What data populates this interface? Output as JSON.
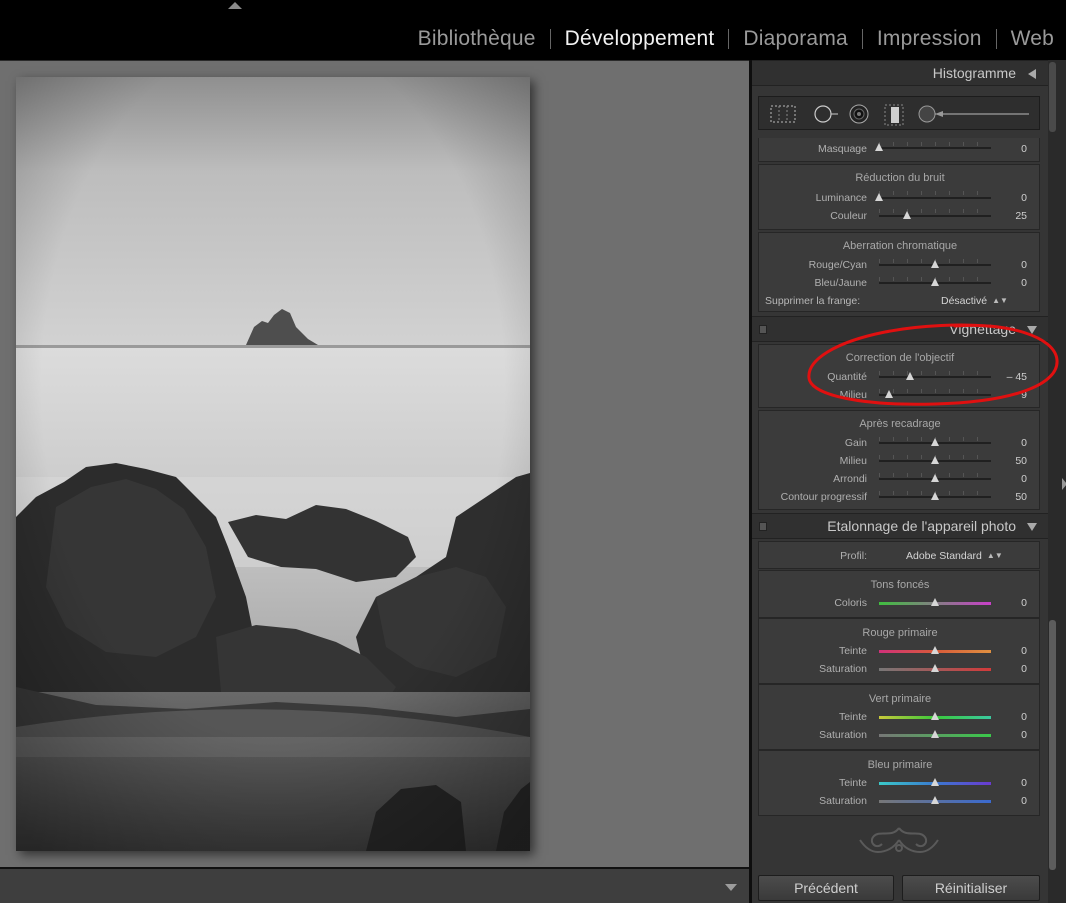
{
  "modules": [
    {
      "label": "Bibliothèque",
      "active": false
    },
    {
      "label": "Développement",
      "active": true
    },
    {
      "label": "Diaporama",
      "active": false
    },
    {
      "label": "Impression",
      "active": false
    },
    {
      "label": "Web",
      "active": false
    }
  ],
  "histogram": {
    "title": "Histogramme"
  },
  "detail": {
    "masquage_label": "Masquage",
    "masquage_value": "0",
    "masquage_fraction": 0.0
  },
  "noise": {
    "title": "Réduction du bruit",
    "rows": [
      {
        "label": "Luminance",
        "value": "0",
        "fraction": 0.0
      },
      {
        "label": "Couleur",
        "value": "25",
        "fraction": 0.25
      }
    ]
  },
  "chromatic": {
    "title": "Aberration chromatique",
    "rows": [
      {
        "label": "Rouge/Cyan",
        "value": "0",
        "fraction": 0.5
      },
      {
        "label": "Bleu/Jaune",
        "value": "0",
        "fraction": 0.5
      }
    ],
    "fringe_label": "Supprimer la frange:",
    "fringe_value": "Désactivé"
  },
  "vignette": {
    "title": "Vignettage",
    "lens_title": "Correction de l'objectif",
    "lens_rows": [
      {
        "label": "Quantité",
        "value": "– 45",
        "fraction": 0.275
      },
      {
        "label": "Milieu",
        "value": "9",
        "fraction": 0.09
      }
    ],
    "crop_title": "Après recadrage",
    "crop_rows": [
      {
        "label": "Gain",
        "value": "0",
        "fraction": 0.5
      },
      {
        "label": "Milieu",
        "value": "50",
        "fraction": 0.5
      },
      {
        "label": "Arrondi",
        "value": "0",
        "fraction": 0.5
      },
      {
        "label": "Contour progressif",
        "value": "50",
        "fraction": 0.5
      }
    ]
  },
  "calibration": {
    "title": "Etalonnage de l'appareil photo",
    "profile_label": "Profil:",
    "profile_value": "Adobe Standard",
    "shadows_title": "Tons foncés",
    "shadows_row": {
      "label": "Coloris",
      "value": "0",
      "fraction": 0.5
    },
    "red_title": "Rouge primaire",
    "red_rows": [
      {
        "label": "Teinte",
        "value": "0",
        "fraction": 0.5
      },
      {
        "label": "Saturation",
        "value": "0",
        "fraction": 0.5
      }
    ],
    "green_title": "Vert primaire",
    "green_rows": [
      {
        "label": "Teinte",
        "value": "0",
        "fraction": 0.5
      },
      {
        "label": "Saturation",
        "value": "0",
        "fraction": 0.5
      }
    ],
    "blue_title": "Bleu primaire",
    "blue_rows": [
      {
        "label": "Teinte",
        "value": "0",
        "fraction": 0.5
      },
      {
        "label": "Saturation",
        "value": "0",
        "fraction": 0.5
      }
    ]
  },
  "buttons": {
    "previous": "Précédent",
    "reset": "Réinitialiser"
  },
  "colors": {
    "annotation": "#e01010",
    "panel": "#353535",
    "background": "#6f6f6f"
  }
}
